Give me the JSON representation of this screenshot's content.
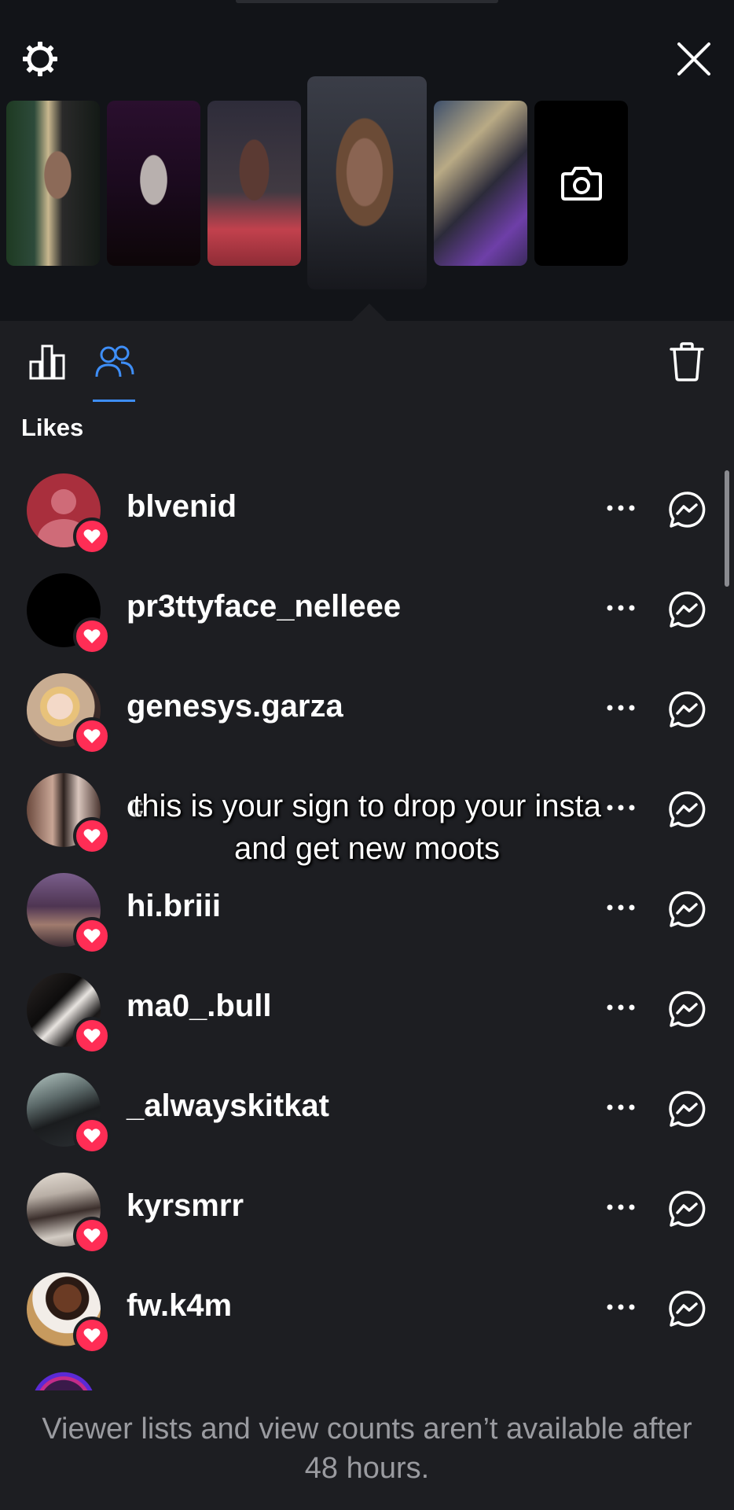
{
  "header": {
    "settings_icon": "gear-icon",
    "close_icon": "close-icon",
    "camera_icon": "camera-icon"
  },
  "tabs": {
    "insights_icon": "bar-chart-icon",
    "viewers_icon": "people-icon",
    "delete_icon": "trash-icon",
    "active_color": "#3e8ef7"
  },
  "section_title": "Likes",
  "viewers": [
    {
      "username": "blvenid"
    },
    {
      "username": "pr3ttyface_nelleee"
    },
    {
      "username": "genesys.garza"
    },
    {
      "username": "c"
    },
    {
      "username": "hi.briii"
    },
    {
      "username": "ma0_.bull"
    },
    {
      "username": "_alwayskitkat"
    },
    {
      "username": "kyrsmrr"
    },
    {
      "username": "fw.k4m"
    }
  ],
  "caption_overlay": "this is your sign to drop your insta and get new moots",
  "footer_note": "Viewer lists and view counts aren’t available after 48 hours.",
  "colors": {
    "background": "#1d1e22",
    "top_background": "#121418",
    "heart_badge": "#ff2d55",
    "muted_text": "#9a9ba0"
  }
}
